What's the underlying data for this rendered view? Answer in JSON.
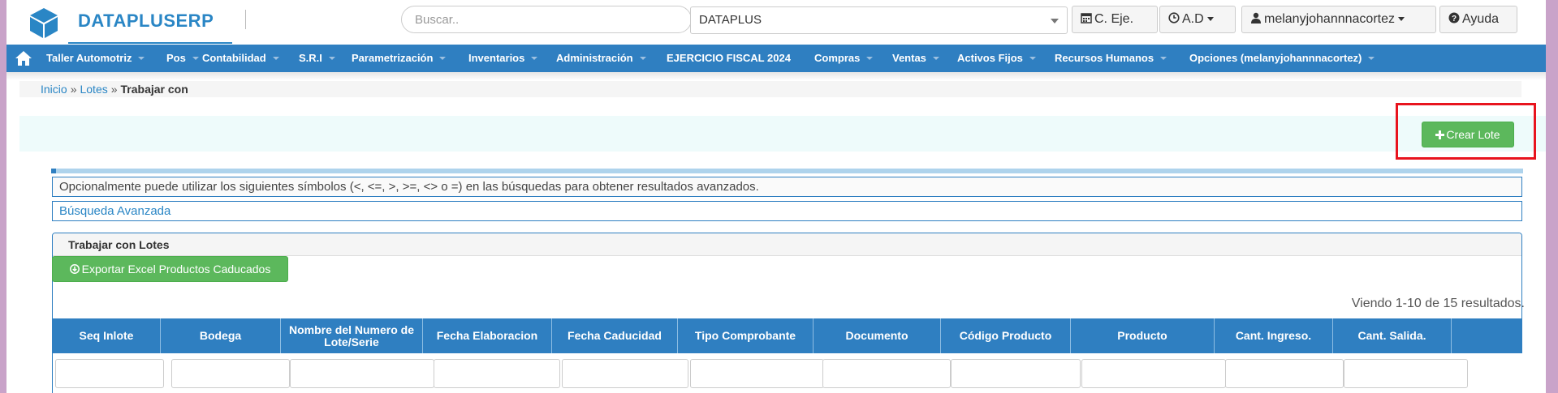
{
  "header": {
    "brand": "DATAPLUSERP",
    "search_placeholder": "Buscar..",
    "company_select_value": "DATAPLUS",
    "btn_ejercicio": "C. Eje.",
    "btn_ad": "A.D",
    "btn_user": "melanyjohannnacortez",
    "btn_help": "Ayuda"
  },
  "nav": {
    "items": [
      {
        "label": "Taller Automotriz"
      },
      {
        "label": "Pos"
      },
      {
        "label": "Contabilidad"
      },
      {
        "label": "S.R.I"
      },
      {
        "label": "Parametrización"
      },
      {
        "label": "Inventarios"
      },
      {
        "label": "Administración"
      },
      {
        "label": "EJERCICIO FISCAL 2024"
      },
      {
        "label": "Compras"
      },
      {
        "label": "Ventas"
      },
      {
        "label": "Activos Fijos"
      },
      {
        "label": "Recursos Humanos"
      },
      {
        "label": "Opciones (melanyjohannnacortez)"
      }
    ]
  },
  "breadcrumb": {
    "home": "Inicio",
    "lotes": "Lotes",
    "separator": "»",
    "current": "Trabajar con"
  },
  "actions": {
    "create_label": "Crear Lote"
  },
  "info_text": "Opcionalmente puede utilizar los siguientes símbolos (<, <=, >, >=, <> o =) en las búsquedas para obtener resultados avanzados.",
  "advanced_search": "Búsqueda Avanzada",
  "panel": {
    "title": "Trabajar con Lotes",
    "export_label": "Exportar Excel Productos Caducados",
    "summary": "Viendo 1-10 de 15 resultados."
  },
  "table": {
    "columns": [
      {
        "label": "Seq Inlote"
      },
      {
        "label": "Bodega"
      },
      {
        "label": "Nombre del Numero de Lote/Serie"
      },
      {
        "label": "Fecha Elaboracion"
      },
      {
        "label": "Fecha Caducidad"
      },
      {
        "label": "Tipo Comprobante"
      },
      {
        "label": "Documento"
      },
      {
        "label": "Código Producto"
      },
      {
        "label": "Producto"
      },
      {
        "label": "Cant. Ingreso."
      },
      {
        "label": "Cant. Salida."
      },
      {
        "label": ""
      }
    ]
  },
  "colors": {
    "primary": "#2f7fc1",
    "success": "#5cb85c",
    "highlight": "#e8141e"
  }
}
